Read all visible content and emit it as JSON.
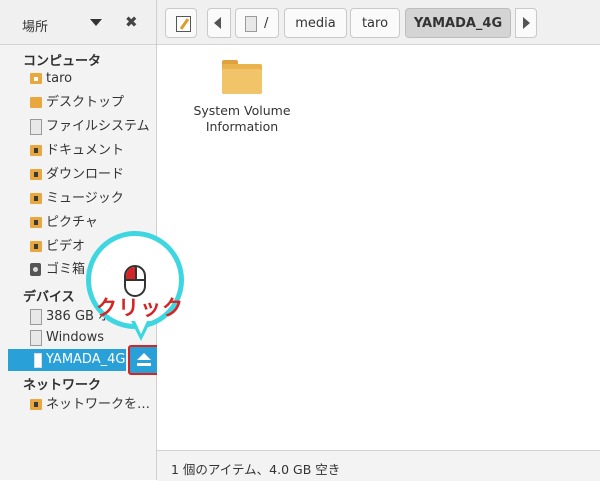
{
  "sidebar": {
    "header": {
      "title": "場所"
    },
    "sections": {
      "computer": "コンピュータ",
      "devices": "デバイス",
      "network": "ネットワーク"
    },
    "computer_items": [
      {
        "label": "taro",
        "icon": "home-folder-icon"
      },
      {
        "label": "デスクトップ",
        "icon": "desktop-folder-icon"
      },
      {
        "label": "ファイルシステム",
        "icon": "drive-icon"
      },
      {
        "label": "ドキュメント",
        "icon": "documents-folder-icon"
      },
      {
        "label": "ダウンロード",
        "icon": "downloads-folder-icon"
      },
      {
        "label": "ミュージック",
        "icon": "music-folder-icon"
      },
      {
        "label": "ピクチャ",
        "icon": "pictures-folder-icon"
      },
      {
        "label": "ビデオ",
        "icon": "videos-folder-icon"
      },
      {
        "label": "ゴミ箱",
        "icon": "trash-icon"
      }
    ],
    "device_items": [
      {
        "label": "386 GB ボ",
        "icon": "drive-icon"
      },
      {
        "label": "Windows",
        "icon": "drive-icon"
      },
      {
        "label": "YAMADA_4G",
        "icon": "usb-drive-icon",
        "selected": true
      }
    ],
    "network_items": [
      {
        "label": "ネットワークを…",
        "icon": "network-folder-icon"
      }
    ]
  },
  "toolbar": {
    "root_label": "/",
    "path": [
      "media",
      "taro",
      "YAMADA_4G"
    ]
  },
  "content": {
    "items": [
      {
        "name": "System Volume Information",
        "icon": "folder-icon"
      }
    ]
  },
  "status": "1 個のアイテム、4.0 GB 空き",
  "callout": {
    "text": "クリック"
  },
  "colors": {
    "selection": "#2aa0d8",
    "callout_border": "#3ed6e0",
    "callout_text": "#d42424"
  }
}
